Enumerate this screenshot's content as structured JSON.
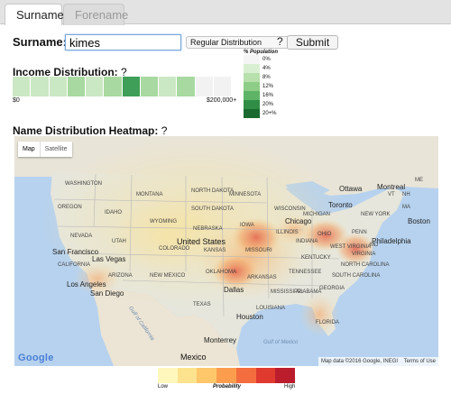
{
  "tabs": [
    {
      "label": "Surname",
      "active": true
    },
    {
      "label": "Forename",
      "active": false
    }
  ],
  "surname_form": {
    "label": "Surname:",
    "value": "kimes",
    "distribution_select": "Regular Distribution",
    "help": "?",
    "submit_label": "Submit"
  },
  "income": {
    "title": "Income Distribution:",
    "help": "?",
    "min_label": "$0",
    "max_label": "$200,000+",
    "bin_colors": [
      "#cbe8c4",
      "#cbe8c4",
      "#cbe8c4",
      "#a8d9a0",
      "#cbe8c4",
      "#a8d9a0",
      "#3f9e57",
      "#a8d9a0",
      "#cbe8c4",
      "#a8d9a0",
      "#f2f2f2",
      "#f2f2f2"
    ]
  },
  "population_legend": {
    "title": "% Population",
    "items": [
      {
        "label": "0%",
        "color": "#f5f5f5"
      },
      {
        "label": "4%",
        "color": "#d9efd2"
      },
      {
        "label": "8%",
        "color": "#b7e0ad"
      },
      {
        "label": "12%",
        "color": "#8dcd87"
      },
      {
        "label": "16%",
        "color": "#5eb466"
      },
      {
        "label": "20%",
        "color": "#2f8d45"
      },
      {
        "label": "20+%",
        "color": "#1a6a30"
      }
    ]
  },
  "heatmap": {
    "title": "Name Distribution Heatmap:",
    "help": "?",
    "map_type_buttons": [
      "Map",
      "Satellite"
    ],
    "country_labels": [
      "United States",
      "Mexico"
    ],
    "state_labels": [
      "WASHINGTON",
      "OREGON",
      "IDAHO",
      "MONTANA",
      "WYOMING",
      "NEVADA",
      "UTAH",
      "COLORADO",
      "ARIZONA",
      "NEW MEXICO",
      "CALIFORNIA",
      "NORTH DAKOTA",
      "SOUTH DAKOTA",
      "NEBRASKA",
      "KANSAS",
      "OKLAHOMA",
      "TEXAS",
      "MINNESOTA",
      "IOWA",
      "MISSOURI",
      "ARKANSAS",
      "WISCONSIN",
      "ILLINOIS",
      "INDIANA",
      "OHIO",
      "MICHIGAN",
      "KENTUCKY",
      "TENNESSEE",
      "MISSISSIPPI",
      "ALABAMA",
      "GEORGIA",
      "FLORIDA",
      "SOUTH CAROLINA",
      "NORTH CAROLINA",
      "VIRGINIA",
      "WEST VIRGINIA",
      "PENN",
      "NEW YORK",
      "ME",
      "VT",
      "NH",
      "MA",
      "LOUISIANA",
      "MD"
    ],
    "city_labels": [
      "Chicago",
      "Ottawa",
      "Montreal",
      "Toronto",
      "Boston",
      "Philadelphia",
      "San Francisco",
      "Las Vegas",
      "Los Angeles",
      "San Diego",
      "Dallas",
      "Houston",
      "Monterrey"
    ],
    "water_labels": [
      "Gulf of Mexico",
      "Gulf of California"
    ],
    "attribution": "Map data ©2016 Google, INEGI",
    "terms": "Terms of Use",
    "logo": "Google"
  },
  "probability_legend": {
    "low": "Low",
    "title": "Probability",
    "high": "High",
    "colors": [
      "#fff7bc",
      "#fee38e",
      "#fdc76a",
      "#fc9d4e",
      "#f46d3e",
      "#e03a2f",
      "#bb1d2d"
    ]
  }
}
